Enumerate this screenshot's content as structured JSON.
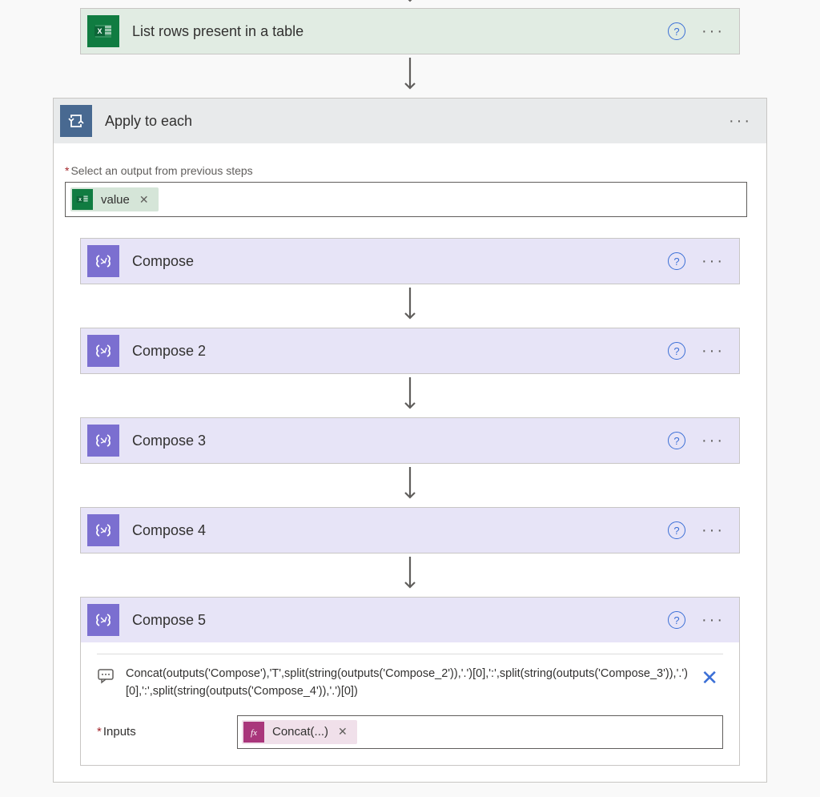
{
  "partial_arrow_visible": true,
  "excel_action": {
    "title": "List rows present in a table",
    "icon": "excel-icon",
    "bg_color": "#107c41"
  },
  "loop_action": {
    "title": "Apply to each",
    "icon": "loop-icon",
    "bg_color": "#486991",
    "input_label": "Select an output from previous steps",
    "required": "*",
    "token": {
      "icon": "excel-icon",
      "text": "value",
      "remove": "✕"
    }
  },
  "compose_actions": [
    {
      "title": "Compose"
    },
    {
      "title": "Compose 2"
    },
    {
      "title": "Compose 3"
    },
    {
      "title": "Compose 4"
    },
    {
      "title": "Compose 5",
      "expanded": true
    }
  ],
  "compose_icon_bg": "#7b6fd0",
  "compose5_details": {
    "description": "Concat(outputs('Compose'),'T',split(string(outputs('Compose_2')),'.')[0],':',split(string(outputs('Compose_3')),'.')[0],':',split(string(outputs('Compose_4')),'.')[0])",
    "inputs_label": "Inputs",
    "required": "*",
    "close": "✕",
    "token": {
      "icon": "fx-icon",
      "text": "Concat(...)",
      "remove": "✕"
    }
  },
  "colors": {
    "excel_green": "#107c41",
    "loop_blue": "#486991",
    "compose_purple": "#7b6fd0",
    "fx_magenta": "#a9367b",
    "link_blue": "#3b6fd6"
  }
}
